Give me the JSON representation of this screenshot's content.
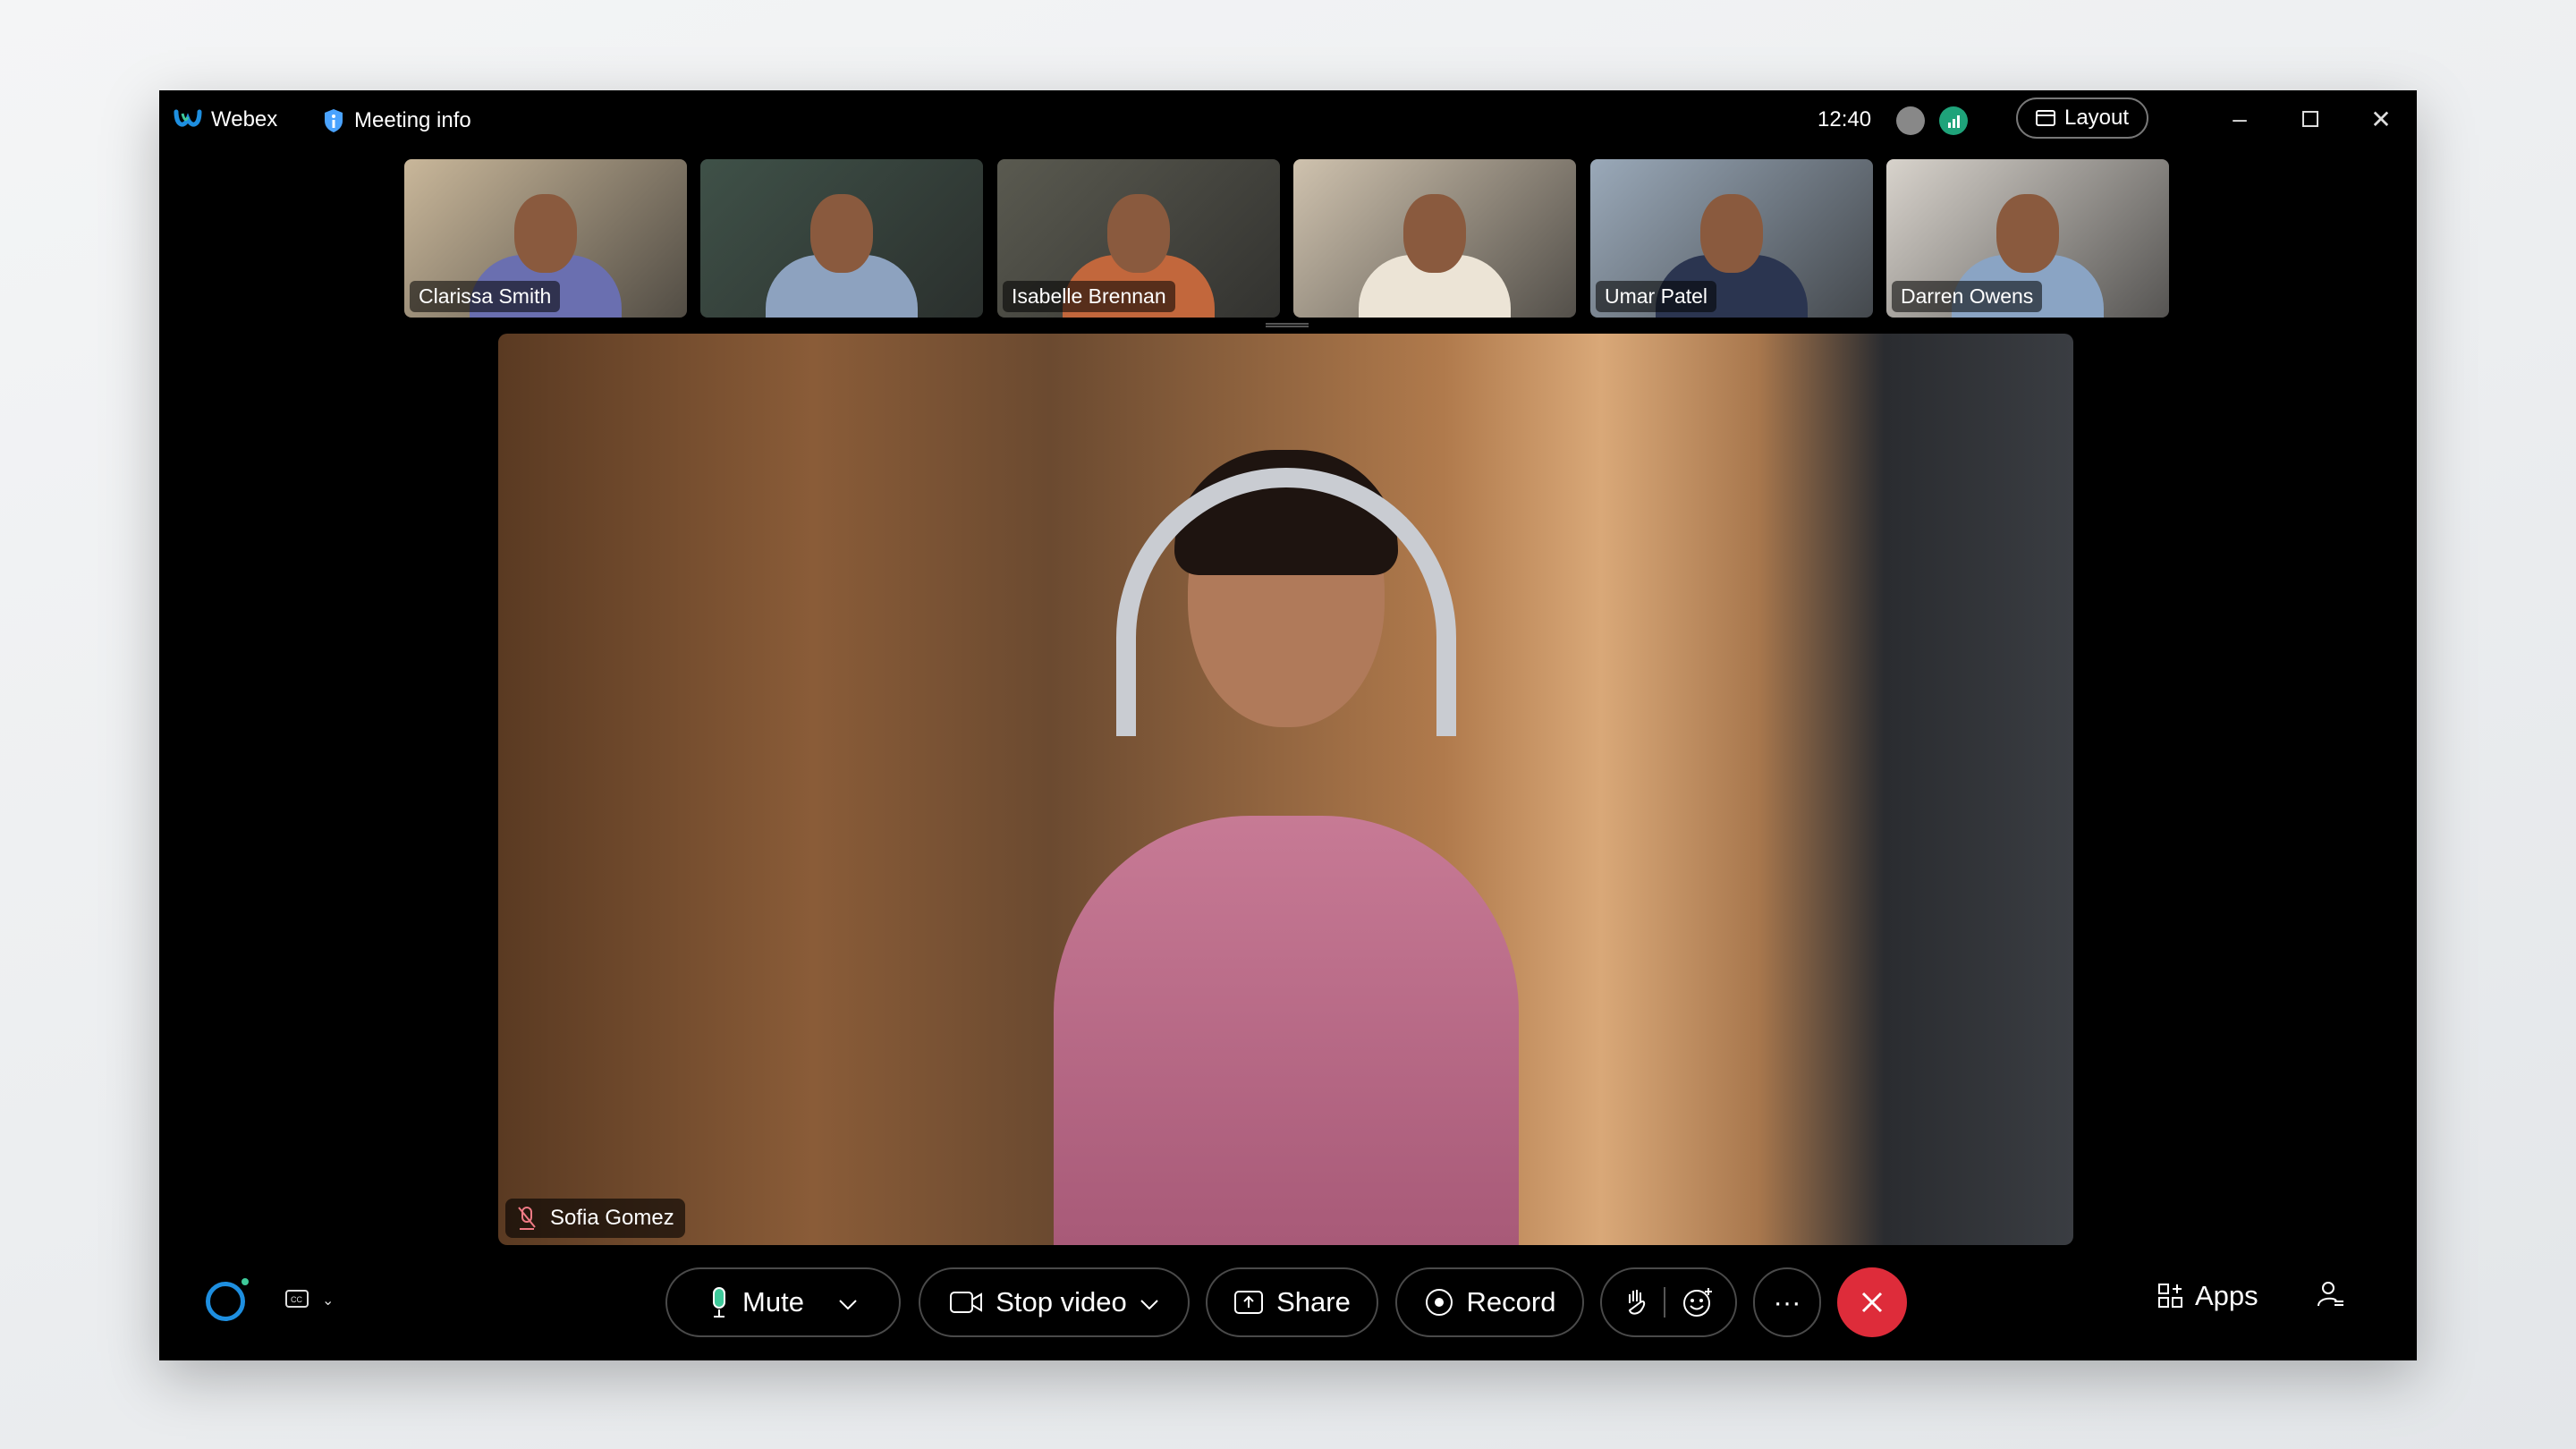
{
  "titlebar": {
    "app_name": "Webex",
    "meeting_info": "Meeting info",
    "time": "12:40",
    "layout_label": "Layout"
  },
  "participants": [
    {
      "name": "Clarissa Smith",
      "bg": "#c9b79a",
      "shirt": "#6a6fb0"
    },
    {
      "name": "",
      "bg": "#3f5148",
      "shirt": "#8da2bf"
    },
    {
      "name": "Isabelle Brennan",
      "bg": "#5a5a50",
      "shirt": "#c2673c"
    },
    {
      "name": "",
      "bg": "#cfc2ae",
      "shirt": "#ece4d6"
    },
    {
      "name": "Umar Patel",
      "bg": "#9aa9b9",
      "shirt": "#2b3550"
    },
    {
      "name": "Darren Owens",
      "bg": "#d8d3cc",
      "shirt": "#8aa4c4"
    }
  ],
  "main_video": {
    "name": "Sofia Gomez",
    "muted": true
  },
  "controls": {
    "mute": "Mute",
    "stop_video": "Stop video",
    "share": "Share",
    "record": "Record",
    "apps": "Apps"
  },
  "colors": {
    "end_call": "#de2c3a",
    "mic_active": "#3ec99a",
    "muted_icon": "#f07a85",
    "webex_blue": "#1e8fe0"
  }
}
